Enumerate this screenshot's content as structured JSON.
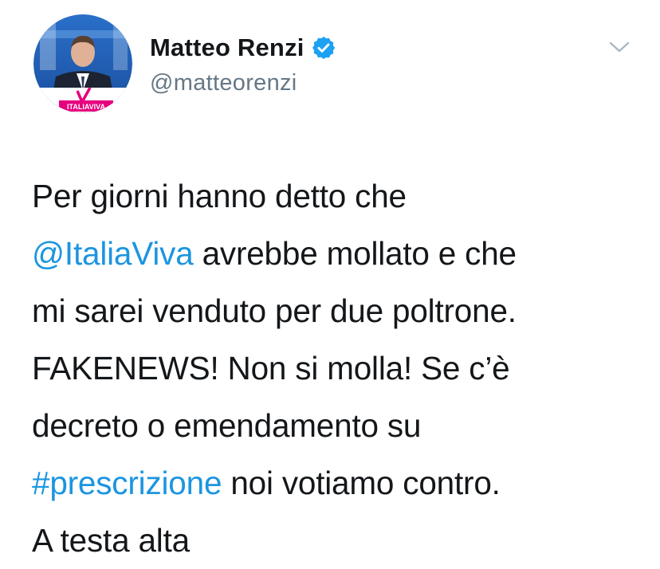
{
  "author": {
    "display_name": "Matteo Renzi",
    "handle": "@matteorenzi",
    "verified": true,
    "avatar_logo_text": "ITALIAVIVA"
  },
  "icons": {
    "verified": "verified-badge-icon",
    "caret": "chevron-down-icon"
  },
  "colors": {
    "link": "#1b95e0",
    "text": "#14171a",
    "handle": "#657786",
    "verified": "#1da1f2",
    "caret": "#aab8c2"
  },
  "tweet": {
    "lines": [
      [
        {
          "text": "Per giorni hanno detto che"
        }
      ],
      [
        {
          "text": "@ItaliaViva",
          "link": true
        },
        {
          "text": " avrebbe mollato e che"
        }
      ],
      [
        {
          "text": "mi sarei venduto per due poltrone."
        }
      ],
      [
        {
          "text": "FAKENEWS! Non si molla! Se c’è"
        }
      ],
      [
        {
          "text": "decreto o emendamento su"
        }
      ],
      [
        {
          "text": "#prescrizione",
          "link": true
        },
        {
          "text": " noi votiamo contro."
        }
      ],
      [
        {
          "text": "A testa alta"
        }
      ]
    ]
  }
}
